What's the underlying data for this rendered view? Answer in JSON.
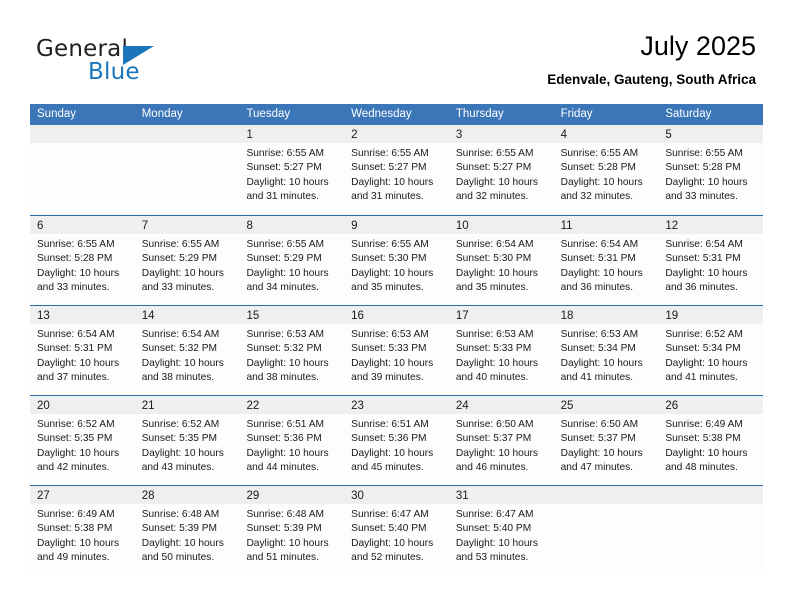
{
  "brand": {
    "name_dark": "General",
    "name_blue": "Blue",
    "triangle_icon": "triangle-icon",
    "accent_color": "#1b75bb"
  },
  "header": {
    "title": "July 2025",
    "subtitle": "Edenvale, Gauteng, South Africa"
  },
  "calendar": {
    "header_bg": "#3b76b8",
    "row_divider": "#2e6da4",
    "date_band_bg": "#efefef",
    "weekdays": [
      "Sunday",
      "Monday",
      "Tuesday",
      "Wednesday",
      "Thursday",
      "Friday",
      "Saturday"
    ],
    "weeks": [
      [
        {
          "day": "",
          "lines": []
        },
        {
          "day": "",
          "lines": []
        },
        {
          "day": "1",
          "lines": [
            "Sunrise: 6:55 AM",
            "Sunset: 5:27 PM",
            "Daylight: 10 hours",
            "and 31 minutes."
          ]
        },
        {
          "day": "2",
          "lines": [
            "Sunrise: 6:55 AM",
            "Sunset: 5:27 PM",
            "Daylight: 10 hours",
            "and 31 minutes."
          ]
        },
        {
          "day": "3",
          "lines": [
            "Sunrise: 6:55 AM",
            "Sunset: 5:27 PM",
            "Daylight: 10 hours",
            "and 32 minutes."
          ]
        },
        {
          "day": "4",
          "lines": [
            "Sunrise: 6:55 AM",
            "Sunset: 5:28 PM",
            "Daylight: 10 hours",
            "and 32 minutes."
          ]
        },
        {
          "day": "5",
          "lines": [
            "Sunrise: 6:55 AM",
            "Sunset: 5:28 PM",
            "Daylight: 10 hours",
            "and 33 minutes."
          ]
        }
      ],
      [
        {
          "day": "6",
          "lines": [
            "Sunrise: 6:55 AM",
            "Sunset: 5:28 PM",
            "Daylight: 10 hours",
            "and 33 minutes."
          ]
        },
        {
          "day": "7",
          "lines": [
            "Sunrise: 6:55 AM",
            "Sunset: 5:29 PM",
            "Daylight: 10 hours",
            "and 33 minutes."
          ]
        },
        {
          "day": "8",
          "lines": [
            "Sunrise: 6:55 AM",
            "Sunset: 5:29 PM",
            "Daylight: 10 hours",
            "and 34 minutes."
          ]
        },
        {
          "day": "9",
          "lines": [
            "Sunrise: 6:55 AM",
            "Sunset: 5:30 PM",
            "Daylight: 10 hours",
            "and 35 minutes."
          ]
        },
        {
          "day": "10",
          "lines": [
            "Sunrise: 6:54 AM",
            "Sunset: 5:30 PM",
            "Daylight: 10 hours",
            "and 35 minutes."
          ]
        },
        {
          "day": "11",
          "lines": [
            "Sunrise: 6:54 AM",
            "Sunset: 5:31 PM",
            "Daylight: 10 hours",
            "and 36 minutes."
          ]
        },
        {
          "day": "12",
          "lines": [
            "Sunrise: 6:54 AM",
            "Sunset: 5:31 PM",
            "Daylight: 10 hours",
            "and 36 minutes."
          ]
        }
      ],
      [
        {
          "day": "13",
          "lines": [
            "Sunrise: 6:54 AM",
            "Sunset: 5:31 PM",
            "Daylight: 10 hours",
            "and 37 minutes."
          ]
        },
        {
          "day": "14",
          "lines": [
            "Sunrise: 6:54 AM",
            "Sunset: 5:32 PM",
            "Daylight: 10 hours",
            "and 38 minutes."
          ]
        },
        {
          "day": "15",
          "lines": [
            "Sunrise: 6:53 AM",
            "Sunset: 5:32 PM",
            "Daylight: 10 hours",
            "and 38 minutes."
          ]
        },
        {
          "day": "16",
          "lines": [
            "Sunrise: 6:53 AM",
            "Sunset: 5:33 PM",
            "Daylight: 10 hours",
            "and 39 minutes."
          ]
        },
        {
          "day": "17",
          "lines": [
            "Sunrise: 6:53 AM",
            "Sunset: 5:33 PM",
            "Daylight: 10 hours",
            "and 40 minutes."
          ]
        },
        {
          "day": "18",
          "lines": [
            "Sunrise: 6:53 AM",
            "Sunset: 5:34 PM",
            "Daylight: 10 hours",
            "and 41 minutes."
          ]
        },
        {
          "day": "19",
          "lines": [
            "Sunrise: 6:52 AM",
            "Sunset: 5:34 PM",
            "Daylight: 10 hours",
            "and 41 minutes."
          ]
        }
      ],
      [
        {
          "day": "20",
          "lines": [
            "Sunrise: 6:52 AM",
            "Sunset: 5:35 PM",
            "Daylight: 10 hours",
            "and 42 minutes."
          ]
        },
        {
          "day": "21",
          "lines": [
            "Sunrise: 6:52 AM",
            "Sunset: 5:35 PM",
            "Daylight: 10 hours",
            "and 43 minutes."
          ]
        },
        {
          "day": "22",
          "lines": [
            "Sunrise: 6:51 AM",
            "Sunset: 5:36 PM",
            "Daylight: 10 hours",
            "and 44 minutes."
          ]
        },
        {
          "day": "23",
          "lines": [
            "Sunrise: 6:51 AM",
            "Sunset: 5:36 PM",
            "Daylight: 10 hours",
            "and 45 minutes."
          ]
        },
        {
          "day": "24",
          "lines": [
            "Sunrise: 6:50 AM",
            "Sunset: 5:37 PM",
            "Daylight: 10 hours",
            "and 46 minutes."
          ]
        },
        {
          "day": "25",
          "lines": [
            "Sunrise: 6:50 AM",
            "Sunset: 5:37 PM",
            "Daylight: 10 hours",
            "and 47 minutes."
          ]
        },
        {
          "day": "26",
          "lines": [
            "Sunrise: 6:49 AM",
            "Sunset: 5:38 PM",
            "Daylight: 10 hours",
            "and 48 minutes."
          ]
        }
      ],
      [
        {
          "day": "27",
          "lines": [
            "Sunrise: 6:49 AM",
            "Sunset: 5:38 PM",
            "Daylight: 10 hours",
            "and 49 minutes."
          ]
        },
        {
          "day": "28",
          "lines": [
            "Sunrise: 6:48 AM",
            "Sunset: 5:39 PM",
            "Daylight: 10 hours",
            "and 50 minutes."
          ]
        },
        {
          "day": "29",
          "lines": [
            "Sunrise: 6:48 AM",
            "Sunset: 5:39 PM",
            "Daylight: 10 hours",
            "and 51 minutes."
          ]
        },
        {
          "day": "30",
          "lines": [
            "Sunrise: 6:47 AM",
            "Sunset: 5:40 PM",
            "Daylight: 10 hours",
            "and 52 minutes."
          ]
        },
        {
          "day": "31",
          "lines": [
            "Sunrise: 6:47 AM",
            "Sunset: 5:40 PM",
            "Daylight: 10 hours",
            "and 53 minutes."
          ]
        },
        {
          "day": "",
          "lines": []
        },
        {
          "day": "",
          "lines": []
        }
      ]
    ]
  }
}
